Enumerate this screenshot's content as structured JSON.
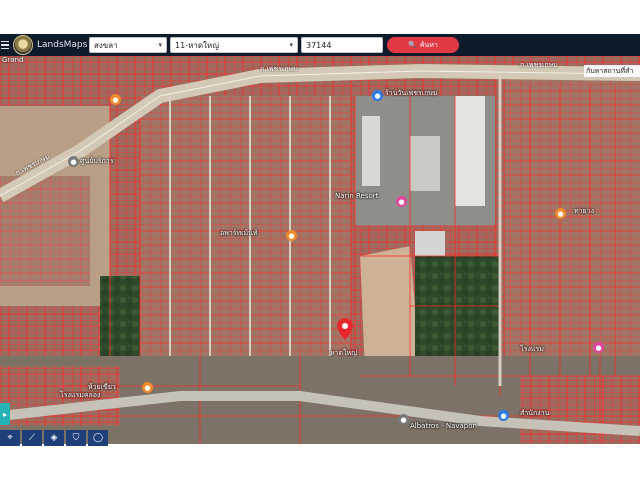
{
  "header": {
    "brand": "LandsMaps",
    "province": "สงขลา",
    "district": "11-หาดใหญ่",
    "parcel_number": "37144",
    "search_label": "ค้นหา"
  },
  "map": {
    "right_box_text": "กับหาสถานที่สำ",
    "road_labels": [
      {
        "name": "ถ.เพชรเกษม",
        "text": "ถ.เพชรเกษม"
      },
      {
        "name": "ถ.เพชรเกษม",
        "text": "ถ.เพชรเกษม"
      },
      {
        "name": "ถ.เพชรเกษม",
        "text": "ถ.เพชรเกษม"
      },
      {
        "name": "grand",
        "text": "Grand"
      }
    ],
    "places": [
      {
        "text": "ร้านวันเพชรเกษม"
      },
      {
        "text": "ศูนย์บริการ"
      },
      {
        "text": "Narin Resort"
      },
      {
        "text": "อพาร์ทเม้นท์"
      },
      {
        "text": "หาดใหญ่"
      },
      {
        "text": "Albatros - Navapon"
      },
      {
        "text": "โรงแรม"
      },
      {
        "text": "ท่ายาง"
      },
      {
        "text": "โรงแรมคลอง"
      },
      {
        "text": "สำนักงาน"
      },
      {
        "text": "ห้วยเขียว"
      }
    ]
  },
  "toolbar": {
    "tools": [
      "location-icon",
      "measure-icon",
      "layers-icon",
      "shield-icon",
      "circle-icon"
    ],
    "side_tab": "layers-tab"
  },
  "colors": {
    "topbar": "#0d1b2a",
    "search_button": "#e23a45",
    "parcel_lines": "#e0312f",
    "pin": "#e8262e"
  }
}
